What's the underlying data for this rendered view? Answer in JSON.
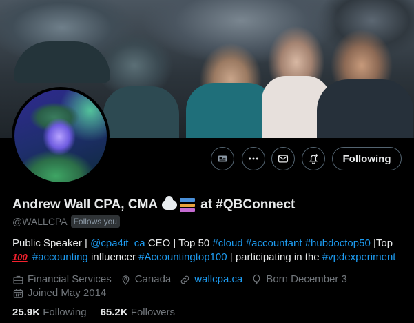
{
  "profile": {
    "name": "Andrew Wall CPA, CMA",
    "name_suffix": "at #QBConnect",
    "handle": "@WALLCPA",
    "follows_you": "Follows you",
    "bio": {
      "p1": "Public Speaker | ",
      "l1": "@cpa4it_ca",
      "p2": " CEO | Top 50 ",
      "l2": "#cloud",
      "p3": " ",
      "l3": "#accountant",
      "p4": " ",
      "l4": "#hubdoctop50",
      "p5": " |Top",
      "hundred": "100",
      "p6": " ",
      "l6": "#accounting",
      "p7": " influencer ",
      "l7": "#Accountingtop100",
      "p8": " | participating in the ",
      "l8": "#vpdexperiment"
    },
    "category": "Financial Services",
    "location": "Canada",
    "website": "wallcpa.ca",
    "born": "Born December 3",
    "joined": "Joined May 2014",
    "following_count": "25.9K",
    "following_label": "Following",
    "followers_count": "65.2K",
    "followers_label": "Followers"
  },
  "actions": {
    "following_button": "Following"
  },
  "icons": {
    "newsletter": "newsletter-icon",
    "more": "more-icon",
    "message": "message-icon",
    "notify": "bell-plus-icon",
    "category": "briefcase-icon",
    "location": "location-pin-icon",
    "website": "link-icon",
    "born": "balloon-icon",
    "joined": "calendar-icon"
  },
  "colors": {
    "background": "#000000",
    "text": "#e7e9ea",
    "muted": "#71767b",
    "link": "#1d9bf0",
    "border": "#536471"
  }
}
